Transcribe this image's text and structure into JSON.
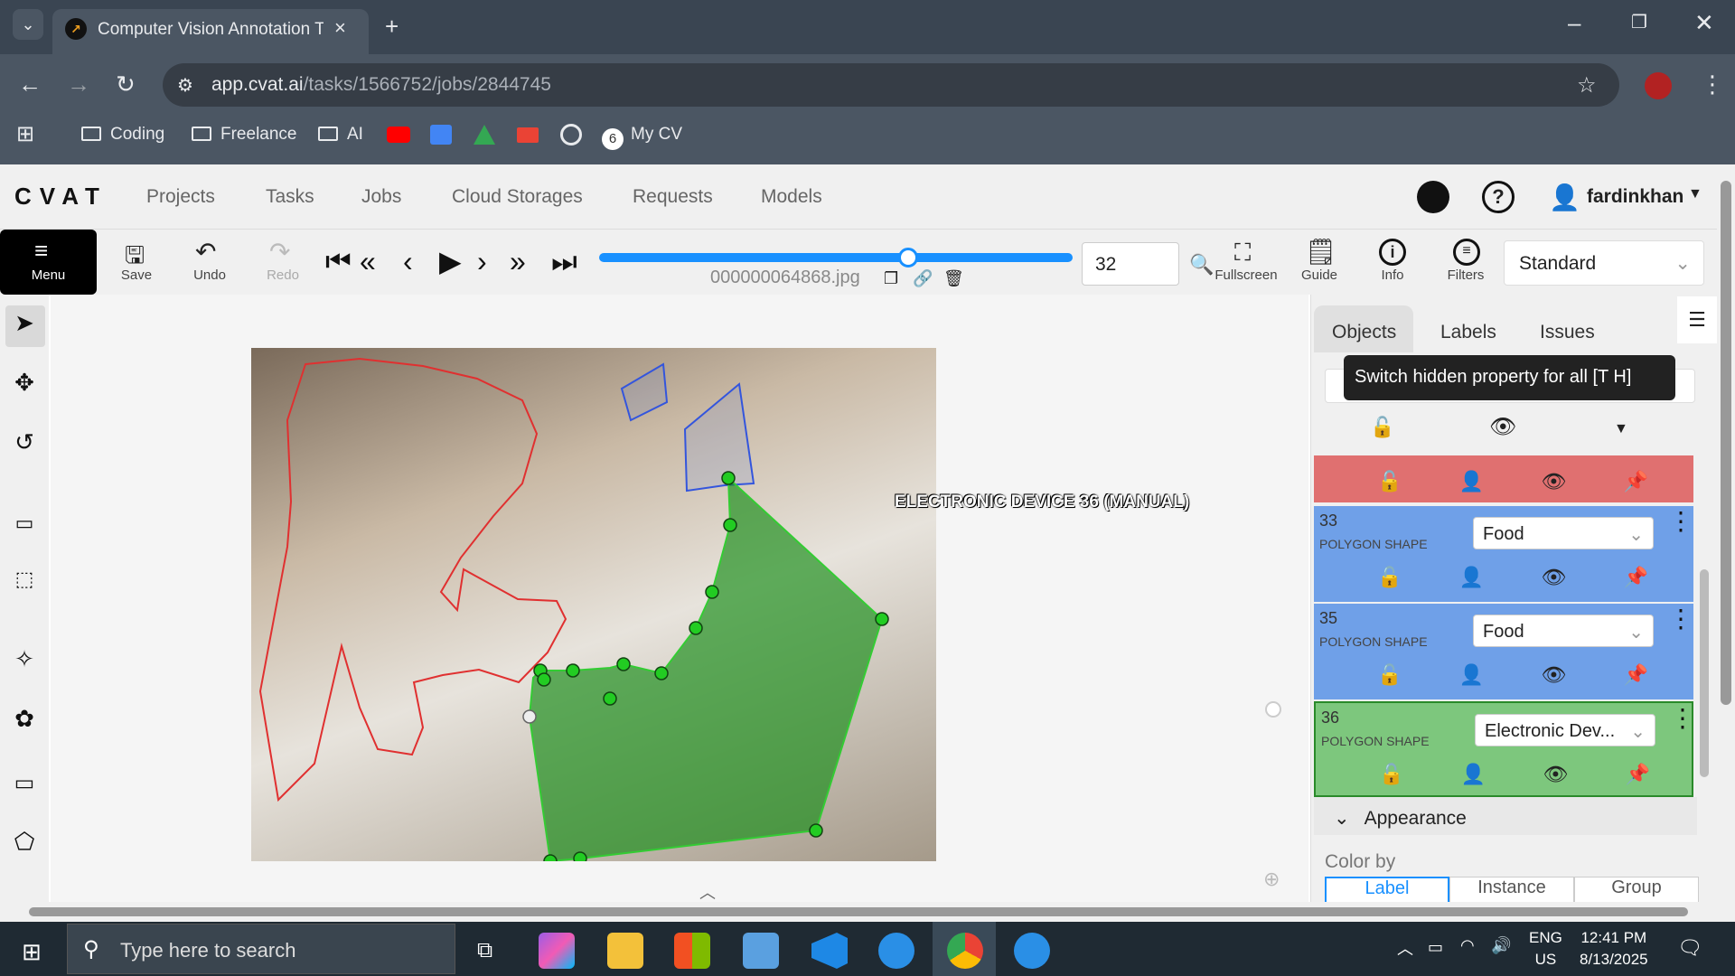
{
  "browser": {
    "tab_title": "Computer Vision Annotation To",
    "url_host": "app.cvat.ai",
    "url_path": "/tasks/1566752/jobs/2844745",
    "bookmarks": [
      "Coding",
      "Freelance",
      "AI",
      "My CV"
    ]
  },
  "header": {
    "logo": "CVAT",
    "nav": [
      "Projects",
      "Tasks",
      "Jobs",
      "Cloud Storages",
      "Requests",
      "Models"
    ],
    "username": "fardinkhan"
  },
  "toolbar": {
    "menu_label": "Menu",
    "save_label": "Save",
    "undo_label": "Undo",
    "redo_label": "Redo",
    "filename": "000000064868.jpg",
    "frame_number": "32",
    "fullscreen_label": "Fullscreen",
    "guide_label": "Guide",
    "info_label": "Info",
    "filters_label": "Filters",
    "workspace": "Standard"
  },
  "canvas": {
    "shape_label": "ELECTRONIC DEVICE 36 (MANUAL)"
  },
  "sidebar": {
    "tabs": [
      "Objects",
      "Labels",
      "Issues"
    ],
    "tooltip": "Switch hidden property for all [T H]",
    "objects": [
      {
        "id": "33",
        "kind": "POLYGON SHAPE",
        "label": "Food",
        "color": "#6fa0e8"
      },
      {
        "id": "35",
        "kind": "POLYGON SHAPE",
        "label": "Food",
        "color": "#6fa0e8"
      },
      {
        "id": "36",
        "kind": "POLYGON SHAPE",
        "label": "Electronic Dev...",
        "color": "#7dc77d"
      }
    ],
    "appearance_label": "Appearance",
    "color_by_label": "Color by",
    "color_by_options": [
      "Label",
      "Instance",
      "Group"
    ]
  },
  "taskbar": {
    "search_placeholder": "Type here to search",
    "lang": "ENG",
    "region": "US",
    "time": "12:41 PM",
    "date": "8/13/2025"
  }
}
